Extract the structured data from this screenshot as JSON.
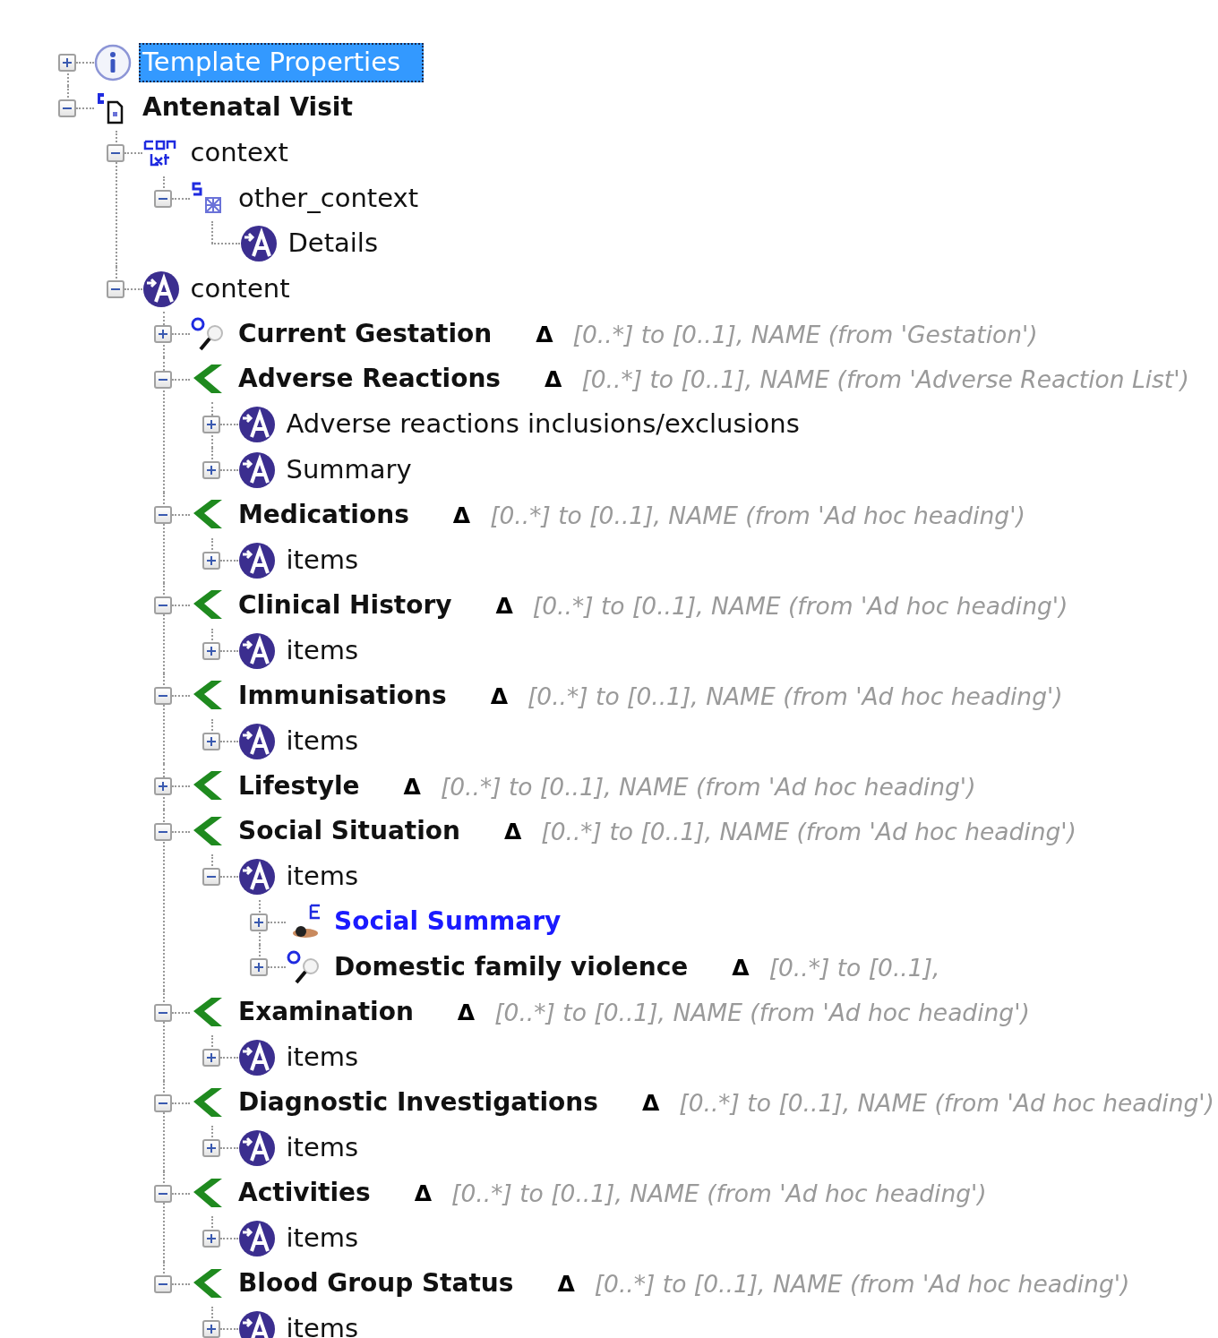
{
  "tree": [
    {
      "label": "Template Properties",
      "kind": "info",
      "expanded": false,
      "selected": true
    },
    {
      "label": "Antenatal Visit",
      "kind": "document",
      "expanded": true,
      "selected": false,
      "children": [
        {
          "label": "context",
          "kind": "context",
          "expanded": true,
          "selected": false,
          "children": [
            {
              "label": "other_context",
              "kind": "structure",
              "expanded": true,
              "selected": false,
              "children": [
                {
                  "label": "Details",
                  "kind": "element",
                  "selected": false
                }
              ]
            }
          ]
        },
        {
          "label": "content",
          "kind": "element",
          "expanded": true,
          "selected": false,
          "children": [
            {
              "label": "Current Gestation",
              "kind": "observation",
              "expanded": false,
              "selected": false,
              "delta": "Δ",
              "note": "[0..*] to [0..1],  NAME (from 'Gestation')"
            },
            {
              "label": "Adverse Reactions",
              "kind": "section",
              "expanded": true,
              "selected": false,
              "delta": "Δ",
              "note": "[0..*] to [0..1],  NAME (from 'Adverse Reaction List')",
              "children": [
                {
                  "label": "Adverse reactions inclusions/exclusions",
                  "kind": "element",
                  "expanded": false,
                  "selected": false
                },
                {
                  "label": "Summary",
                  "kind": "element",
                  "expanded": false,
                  "selected": false
                }
              ]
            },
            {
              "label": "Medications",
              "kind": "section",
              "expanded": true,
              "selected": false,
              "delta": "Δ",
              "note": "[0..*] to [0..1],  NAME (from 'Ad hoc heading')",
              "children": [
                {
                  "label": "items",
                  "kind": "element",
                  "expanded": false,
                  "selected": false
                }
              ]
            },
            {
              "label": "Clinical History",
              "kind": "section",
              "expanded": true,
              "selected": false,
              "delta": "Δ",
              "note": "[0..*] to [0..1],  NAME (from 'Ad hoc heading')",
              "children": [
                {
                  "label": "items",
                  "kind": "element",
                  "expanded": false,
                  "selected": false
                }
              ]
            },
            {
              "label": "Immunisations",
              "kind": "section",
              "expanded": true,
              "selected": false,
              "delta": "Δ",
              "note": "[0..*] to [0..1],  NAME (from 'Ad hoc heading')",
              "children": [
                {
                  "label": "items",
                  "kind": "element",
                  "expanded": false,
                  "selected": false
                }
              ]
            },
            {
              "label": "Lifestyle",
              "kind": "section",
              "expanded": false,
              "selected": false,
              "delta": "Δ",
              "note": "[0..*] to [0..1],  NAME (from 'Ad hoc heading')"
            },
            {
              "label": "Social Situation",
              "kind": "section",
              "expanded": true,
              "selected": false,
              "delta": "Δ",
              "note": "[0..*] to [0..1],  NAME (from 'Ad hoc heading')",
              "children": [
                {
                  "label": "items",
                  "kind": "element",
                  "expanded": true,
                  "selected": false,
                  "children": [
                    {
                      "label": "Social Summary",
                      "kind": "evaluation",
                      "expanded": false,
                      "selected": false
                    },
                    {
                      "label": "Domestic family violence",
                      "kind": "observation",
                      "expanded": false,
                      "selected": false,
                      "delta": "Δ",
                      "note": "[0..*] to [0..1],"
                    }
                  ]
                }
              ]
            },
            {
              "label": "Examination",
              "kind": "section",
              "expanded": true,
              "selected": false,
              "delta": "Δ",
              "note": "[0..*] to [0..1],  NAME (from 'Ad hoc heading')",
              "children": [
                {
                  "label": "items",
                  "kind": "element",
                  "expanded": false,
                  "selected": false
                }
              ]
            },
            {
              "label": "Diagnostic Investigations",
              "kind": "section",
              "expanded": true,
              "selected": false,
              "delta": "Δ",
              "note": "[0..*] to [0..1],  NAME (from 'Ad hoc heading')",
              "children": [
                {
                  "label": "items",
                  "kind": "element",
                  "expanded": false,
                  "selected": false
                }
              ]
            },
            {
              "label": "Activities",
              "kind": "section",
              "expanded": true,
              "selected": false,
              "delta": "Δ",
              "note": "[0..*] to [0..1],  NAME (from 'Ad hoc heading')",
              "children": [
                {
                  "label": "items",
                  "kind": "element",
                  "expanded": false,
                  "selected": false
                }
              ]
            },
            {
              "label": "Blood Group Status",
              "kind": "section",
              "expanded": true,
              "selected": false,
              "delta": "Δ",
              "note": "[0..*] to [0..1],  NAME (from 'Ad hoc heading')",
              "children": [
                {
                  "label": "items",
                  "kind": "element",
                  "expanded": false,
                  "selected": false
                }
              ]
            }
          ]
        }
      ]
    }
  ]
}
